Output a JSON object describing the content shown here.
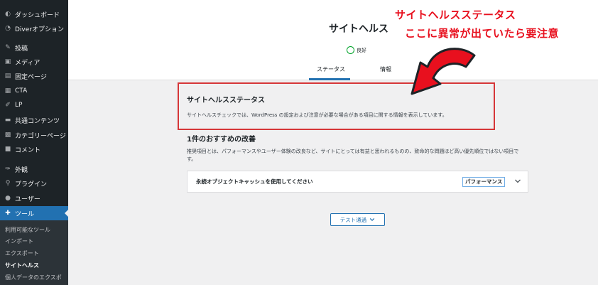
{
  "sidebar": {
    "items": [
      {
        "label": "ダッシュボード",
        "icon": "dashboard-icon"
      },
      {
        "label": "Diverオプション",
        "icon": "diver-icon"
      },
      {
        "label": "投稿",
        "icon": "pin-icon"
      },
      {
        "label": "メディア",
        "icon": "media-icon"
      },
      {
        "label": "固定ページ",
        "icon": "page-icon"
      },
      {
        "label": "CTA",
        "icon": "cta-icon"
      },
      {
        "label": "LP",
        "icon": "lp-icon"
      },
      {
        "label": "共通コンテンツ",
        "icon": "folder-icon"
      },
      {
        "label": "カテゴリーページ",
        "icon": "category-icon"
      },
      {
        "label": "コメント",
        "icon": "comment-icon"
      },
      {
        "label": "外観",
        "icon": "brush-icon"
      },
      {
        "label": "プラグイン",
        "icon": "plugin-icon"
      },
      {
        "label": "ユーザー",
        "icon": "user-icon"
      },
      {
        "label": "ツール",
        "icon": "wrench-icon"
      }
    ],
    "submenu": [
      "利用可能なツール",
      "インポート",
      "エクスポート",
      "サイトヘルス",
      "個人データのエクスポ"
    ]
  },
  "header": {
    "title": "サイトヘルス",
    "status": "良好",
    "tabs": [
      {
        "label": "ステータス"
      },
      {
        "label": "情報"
      }
    ]
  },
  "main": {
    "panel_title": "サイトヘルスステータス",
    "panel_desc": "サイトヘルスチェックでは、WordPress の設定および注意が必要な場合がある項目に関する情報を表示しています。",
    "rec_heading": "1件のおすすめの改善",
    "rec_desc": "推奨項目とは、パフォーマンスやユーザー体験の改良など、サイトにとっては有益と思われるものの、致命的な問題ほど高い優先順位ではない項目です。",
    "accordion": {
      "title": "永続オブジェクトキャッシュを使用してください",
      "badge": "パフォーマンス"
    },
    "passed_button": "テスト通過"
  },
  "annotation": {
    "line1": "サイトヘルスステータス",
    "line2": "ここに異常が出ていたら要注意"
  },
  "colors": {
    "accent": "#2271b1",
    "sidebar_bg": "#1d2327",
    "alert": "#d63638",
    "good": "#00a32a"
  }
}
